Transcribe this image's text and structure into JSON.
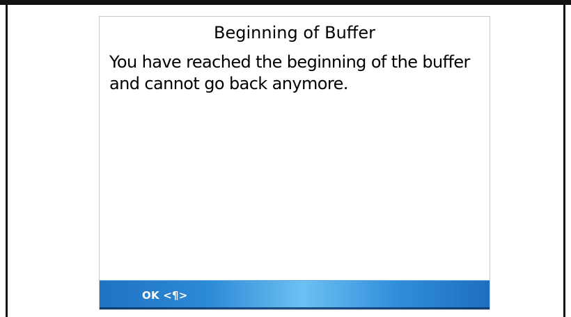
{
  "dialog": {
    "title": "Beginning of Buffer",
    "message": "You have reached the beginning of the buffer and cannot go back anymore."
  },
  "softkeys": {
    "left_label": "OK <¶>"
  },
  "colors": {
    "softkey_bar_dark": "#1f73c4",
    "softkey_bar_light": "#6cc1f2",
    "frame": "#111111",
    "dialog_bg": "#ffffff"
  }
}
